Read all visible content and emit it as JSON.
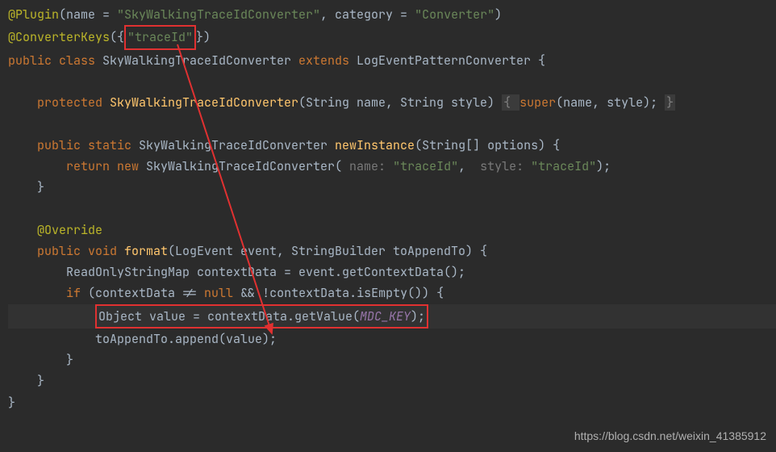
{
  "code": {
    "line1": {
      "ann": "@Plugin",
      "rest1": "(name = ",
      "str1": "\"SkyWalkingTraceIdConverter\"",
      "rest2": ", category = ",
      "str2": "\"Converter\"",
      "rest3": ")"
    },
    "line2": {
      "ann": "@ConverterKeys",
      "rest1": "({",
      "boxed": "\"traceId\"",
      "rest2": "})"
    },
    "line3": {
      "kw1": "public class ",
      "cls": "SkyWalkingTraceIdConverter ",
      "kw2": "extends ",
      "parent": "LogEventPatternConverter {"
    },
    "line4": "",
    "line5": {
      "indent": "    ",
      "kw": "protected ",
      "name": "SkyWalkingTraceIdConverter",
      "params": "(String name, String style) ",
      "b1": "{ ",
      "super": "super",
      "rest": "(name, style); ",
      "b2": "}"
    },
    "line6": "",
    "line7": {
      "indent": "    ",
      "kw": "public static ",
      "type": "SkyWalkingTraceIdConverter ",
      "method": "newInstance",
      "params": "(String[] options) {"
    },
    "line8": {
      "indent": "        ",
      "kw1": "return new ",
      "type": "SkyWalkingTraceIdConverter( ",
      "hint1": "name: ",
      "str1": "\"traceId\"",
      "comma": ",  ",
      "hint2": "style: ",
      "str2": "\"traceId\"",
      "end": ");"
    },
    "line9": "    }",
    "line10": "",
    "line11": {
      "indent": "    ",
      "ann": "@Override"
    },
    "line12": {
      "indent": "    ",
      "kw": "public void ",
      "method": "format",
      "params": "(LogEvent event, StringBuilder toAppendTo) {"
    },
    "line13": {
      "indent": "        ",
      "text": "ReadOnlyStringMap contextData = event.getContextData();"
    },
    "line14": {
      "indent": "        ",
      "kw": "if ",
      "rest1": "(contextData != ",
      "null": "null ",
      "op": "&& ",
      "rest2": "!contextData.isEmpty()) {"
    },
    "line15": {
      "indent": "            ",
      "boxed_pre": "Object value = contextData.getValue(",
      "const": "MDC_KEY",
      "boxed_post": ");"
    },
    "line16": {
      "indent": "            ",
      "text": "toAppendTo.append(value);"
    },
    "line17": "        }",
    "line18": "    }",
    "line19": "}",
    "watermark": "https://blog.csdn.net/weixin_41385912"
  }
}
